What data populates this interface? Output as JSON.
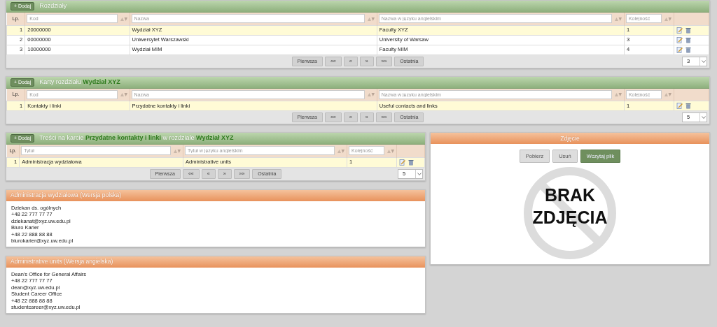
{
  "sections": [
    {
      "add_label": "+ Dodaj",
      "title": [
        {
          "text": "Rozdziały",
          "highlight": false
        }
      ],
      "lp_header": "Lp.",
      "filters": [
        {
          "placeholder": "Kod"
        },
        {
          "placeholder": "Nazwa"
        },
        {
          "placeholder": "Nazwa w języku angielskim"
        },
        {
          "placeholder": "Kolejność"
        }
      ],
      "rows": [
        {
          "lp": "1",
          "cells": [
            "20000000",
            "Wydział XYZ",
            "Faculty XYZ",
            "1"
          ],
          "selected": true
        },
        {
          "lp": "2",
          "cells": [
            "00000000",
            "Uniwersytet Warszawski",
            "University of Warsaw",
            "3"
          ],
          "selected": false
        },
        {
          "lp": "3",
          "cells": [
            "10000000",
            "Wydział MIM",
            "Faculty MIM",
            "4"
          ],
          "selected": false
        }
      ],
      "pager": [
        "Pierwsza",
        "««",
        "«",
        "»",
        "»»",
        "Ostatnia"
      ],
      "page_size": "3"
    },
    {
      "add_label": "+ Dodaj",
      "title": [
        {
          "text": "Karty rozdziału ",
          "highlight": false
        },
        {
          "text": "Wydział XYZ",
          "highlight": true
        }
      ],
      "lp_header": "Lp.",
      "filters": [
        {
          "placeholder": "Kod"
        },
        {
          "placeholder": "Nazwa"
        },
        {
          "placeholder": "Nazwa w języku angielskim"
        },
        {
          "placeholder": "Kolejność"
        }
      ],
      "rows": [
        {
          "lp": "1",
          "cells": [
            "Kontakty i linki",
            "Przydatne kontakty i linki",
            "Useful contacts and links",
            "1"
          ],
          "selected": true
        }
      ],
      "pager": [
        "Pierwsza",
        "««",
        "«",
        "»",
        "»»",
        "Ostatnia"
      ],
      "page_size": "5"
    },
    {
      "add_label": "+ Dodaj",
      "title": [
        {
          "text": "Treści na karcie ",
          "highlight": false
        },
        {
          "text": "Przydatne kontakty i linki",
          "highlight": true
        },
        {
          "text": " w rozdziale ",
          "highlight": false
        },
        {
          "text": "Wydział XYZ",
          "highlight": true
        }
      ],
      "lp_header": "Lp.",
      "filters": [
        {
          "placeholder": "Tytuł"
        },
        {
          "placeholder": "Tytuł w języku angielskim"
        },
        {
          "placeholder": "Kolejność"
        }
      ],
      "rows": [
        {
          "lp": "1",
          "cells": [
            "Administracja wydziałowa",
            "Administrative units",
            "1"
          ],
          "selected": true
        }
      ],
      "pager": [
        "Pierwsza",
        "««",
        "«",
        "»",
        "»»",
        "Ostatnia"
      ],
      "page_size": "5"
    }
  ],
  "text_panels": [
    {
      "title": "Administracja wydziałowa (Wersja polska)",
      "lines": [
        "Dziekan ds. ogólnych",
        "+48 22 777 77 77",
        "dziekanat@xyz.uw.edu.pl",
        "Biuro Karier",
        "+48 22 888 88 88",
        "biurokarier@xyz.uw.edu.pl"
      ]
    },
    {
      "title": "Administrative units (Wersja angielska)",
      "lines": [
        "Dean's Office for General Affairs",
        "+48 22 777 77 77",
        "dean@xyz.uw.edu.pl",
        "Student Career Office",
        "+48 22 888 88 88",
        "studentcareer@xyz.uw.edu.pl"
      ]
    }
  ],
  "photo": {
    "title": "Zdjęcie",
    "buttons": [
      {
        "label": "Pobierz",
        "kind": "default"
      },
      {
        "label": "Usuń",
        "kind": "default"
      },
      {
        "label": "Wczytaj plik",
        "kind": "primary"
      }
    ],
    "no_photo_lines": [
      "BRAK",
      "ZDJĘCIA"
    ]
  }
}
